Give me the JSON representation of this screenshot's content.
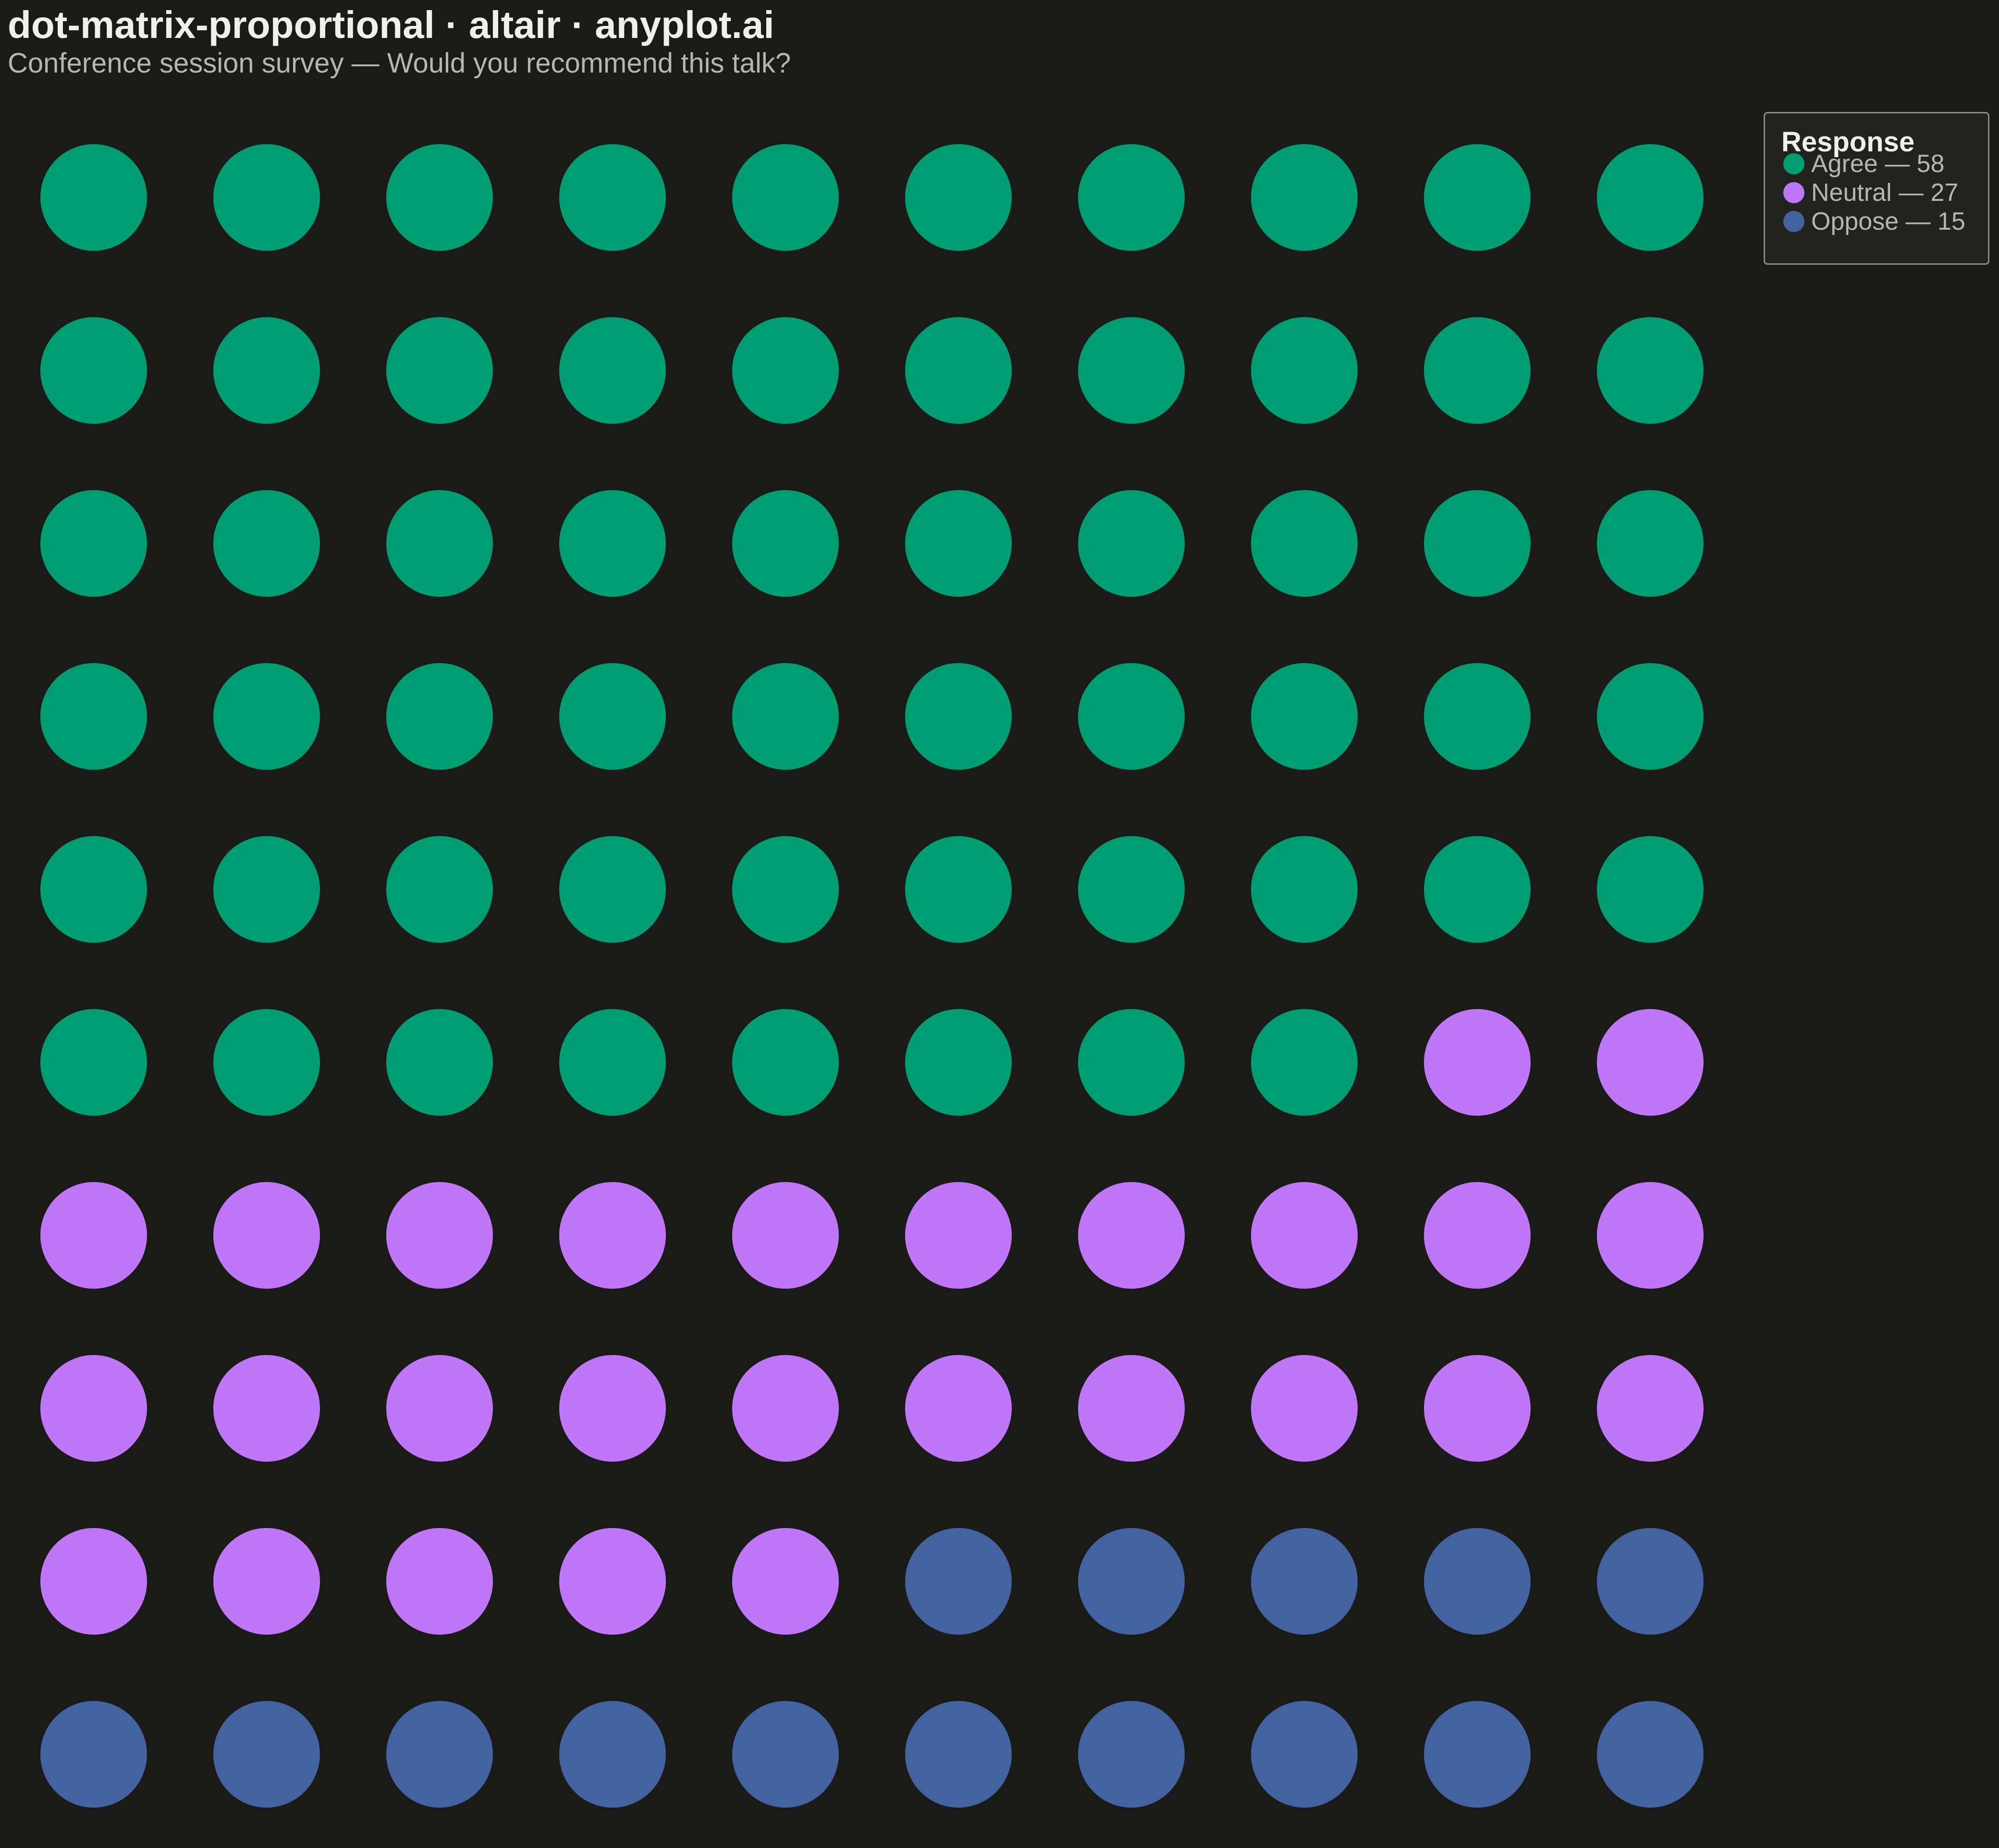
{
  "title": "dot-matrix-proportional · altair · anyplot.ai",
  "subtitle": "Conference session survey — Would you recommend this talk?",
  "chart_data": {
    "type": "dot-matrix",
    "grid": {
      "rows": 10,
      "cols": 10
    },
    "fill_order": "row-major, left-to-right, top-to-bottom",
    "legend_title": "Response",
    "legend_placement": "top-right",
    "categories": [
      {
        "name": "Agree",
        "count": 58,
        "color": "#009e73",
        "label": "Agree — 58"
      },
      {
        "name": "Neutral",
        "count": 27,
        "color": "#c077f7",
        "label": "Neutral — 27"
      },
      {
        "name": "Oppose",
        "count": 15,
        "color": "#4363a0",
        "label": "Oppose — 15"
      }
    ],
    "total": 100
  },
  "colors": {
    "background": "#1a1a17",
    "title": "#f0efe8",
    "subtitle": "#b8b6ac"
  }
}
